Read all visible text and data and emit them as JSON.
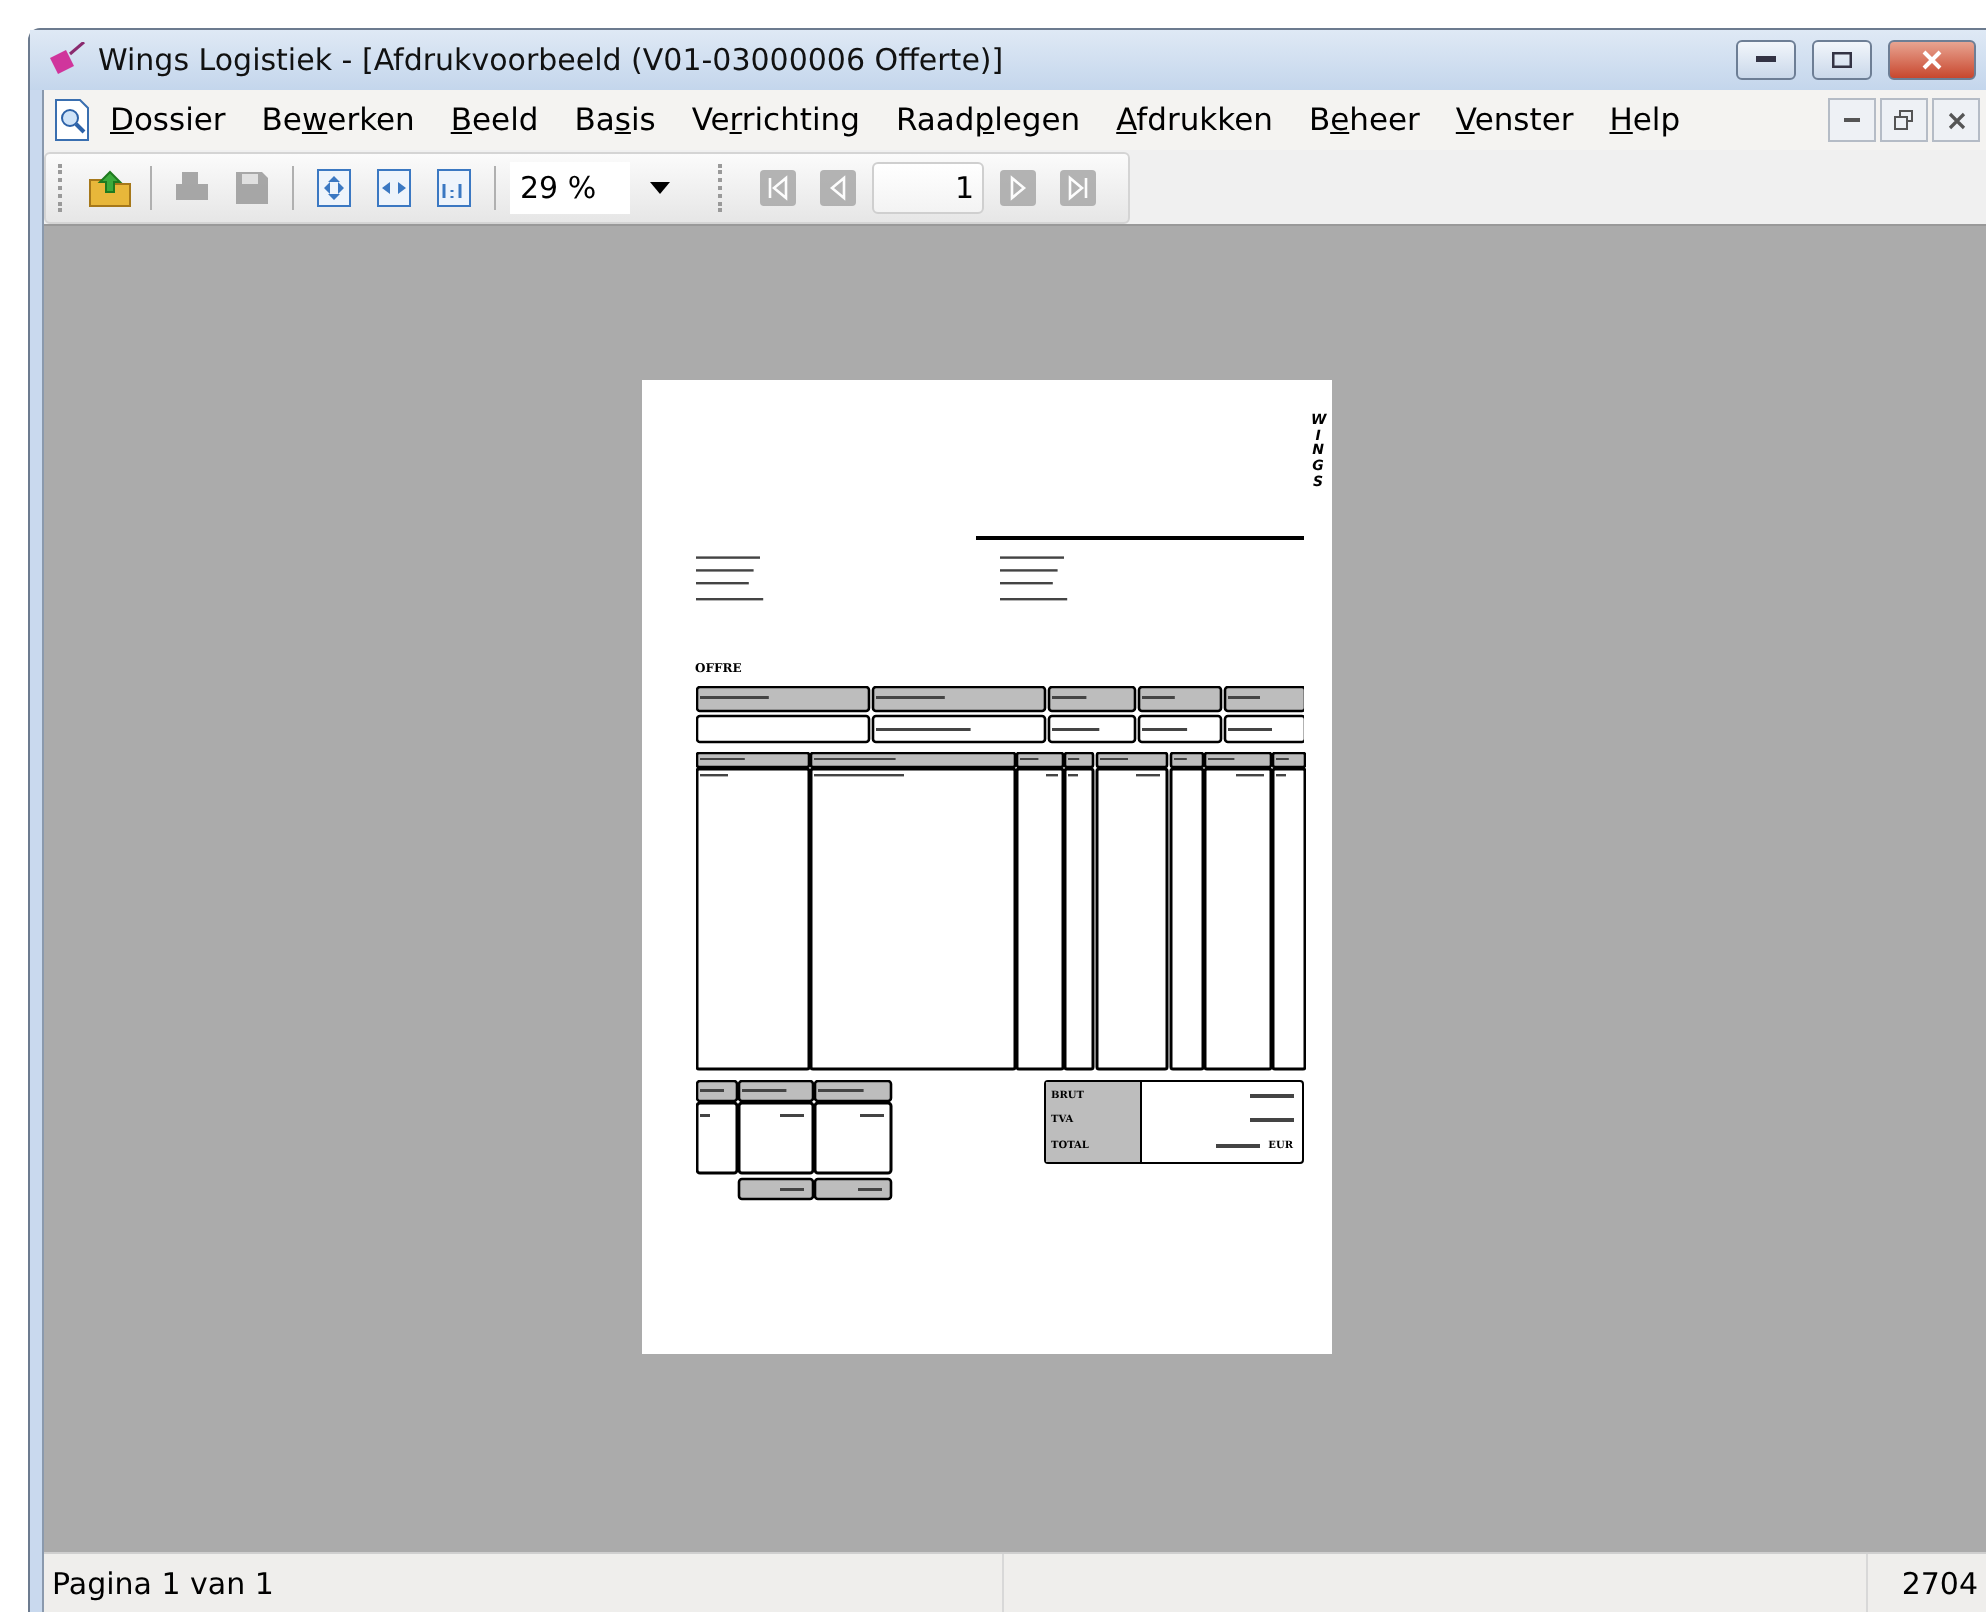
{
  "window": {
    "title": "Wings Logistiek - [Afdrukvoorbeeld (V01-03000006 Offerte)]"
  },
  "menu": [
    {
      "key": "D",
      "after": "ossier"
    },
    {
      "before": "Be",
      "key": "w",
      "after": "erken"
    },
    {
      "key": "B",
      "after": "eeld"
    },
    {
      "before": "Ba",
      "key": "s",
      "after": "is"
    },
    {
      "before": "Ve",
      "key": "r",
      "after": "richting"
    },
    {
      "before": "Raad",
      "key": "p",
      "after": "legen"
    },
    {
      "key": "A",
      "after": "fdrukken"
    },
    {
      "before": "B",
      "key": "e",
      "after": "heer"
    },
    {
      "key": "V",
      "after": "enster"
    },
    {
      "key": "H",
      "after": "elp"
    }
  ],
  "toolbar": [
    {
      "kind": "export",
      "disabled": false
    },
    {
      "kind": "separator"
    },
    {
      "kind": "print",
      "disabled": true
    },
    {
      "kind": "save",
      "disabled": true
    },
    {
      "kind": "separator"
    },
    {
      "kind": "fit_page",
      "disabled": false
    },
    {
      "kind": "fit_width",
      "disabled": false
    },
    {
      "kind": "actual_size",
      "disabled": false
    },
    {
      "kind": "separator"
    },
    {
      "kind": "zoom",
      "value": "29 %"
    },
    {
      "kind": "grip"
    },
    {
      "kind": "first",
      "disabled": true
    },
    {
      "kind": "prev",
      "disabled": true
    },
    {
      "kind": "page",
      "value": "1"
    },
    {
      "kind": "next",
      "disabled": true
    },
    {
      "kind": "last",
      "disabled": true
    }
  ],
  "page": {
    "logo": "WINGS",
    "heading": "OFFRE",
    "totals": [
      {
        "label": "BRUT"
      },
      {
        "label": "TVA"
      },
      {
        "label": "TOTAL",
        "currency": "EUR"
      }
    ]
  },
  "status_bar": [
    {
      "text": "Pagina 1 van 1"
    },
    {
      "text": "2704"
    }
  ]
}
